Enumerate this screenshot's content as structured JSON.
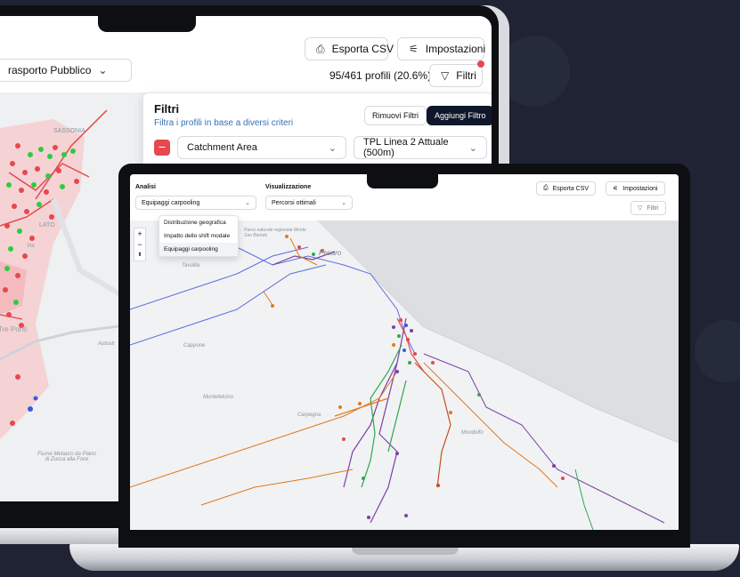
{
  "back_app": {
    "mode_select": "rasporto Pubblico",
    "export_label": "Esporta CSV",
    "settings_label": "Impostazioni",
    "profile_count": "95/461 profili (20.6%)",
    "filters_label": "Filtri",
    "filters_panel": {
      "title": "Filtri",
      "subtitle": "Filtra i profili in base a diversi criteri",
      "remove_label": "Rimuovi Filtri",
      "add_label": "Aggiungi Filtro",
      "field_select": "Catchment Area",
      "value_select": "TPL Linea 2 Attuale (500m)"
    },
    "map_labels": {
      "sassonia": "SASSONIA",
      "lato": "LATO",
      "tre_ponti": "Tre Ponti",
      "autostrada": "Autostr",
      "via": "Via",
      "fiume": "Fiume Metauro da Piano di Zucca alla Foce"
    }
  },
  "front_app": {
    "analysis_label": "Analisi",
    "analysis_select": "Equipaggi carpooling",
    "viz_label": "Visualizzazione",
    "viz_select": "Percorsi ottimali",
    "export_label": "Esporta CSV",
    "settings_label": "Impostazioni",
    "filters_label": "Filtri",
    "dropdown_items": [
      "Distribuzione geografica",
      "Impatto dello shift modale",
      "Equipaggi carpooling"
    ],
    "zoom": {
      "plus": "+",
      "minus": "−",
      "compass": "⬆"
    },
    "map_labels": {
      "pesaro": "Pesaro",
      "tavullia": "Tavullia",
      "cappone": "Cappone",
      "carpegna": "Carpegna",
      "montefelcino": "Montefelcino",
      "mondolfo": "Mondolfo",
      "monte_san_bartolo": "Parco naturale regionale Monte San Bartolo"
    }
  },
  "colors": {
    "background": "#1f2333",
    "danger": "#e5484d",
    "primary_dark": "#0f172a",
    "link_blue": "#3b6fb6"
  }
}
